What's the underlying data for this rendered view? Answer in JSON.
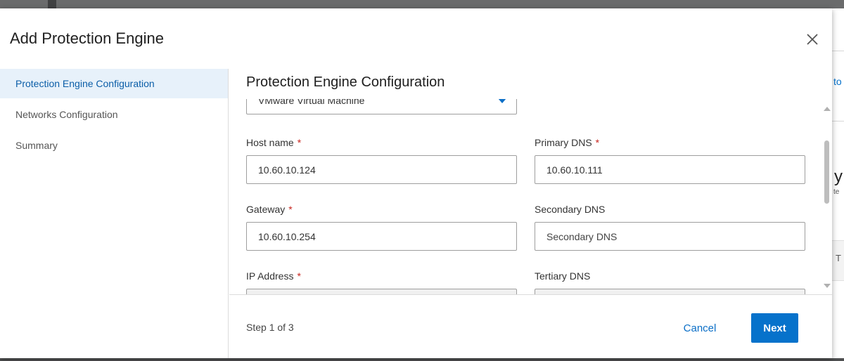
{
  "dialog": {
    "title": "Add Protection Engine"
  },
  "sidebar": {
    "items": [
      {
        "label": "Protection Engine Configuration",
        "active": true
      },
      {
        "label": "Networks Configuration",
        "active": false
      },
      {
        "label": "Summary",
        "active": false
      }
    ]
  },
  "main": {
    "section_title": "Protection Engine Configuration",
    "deployment_select": {
      "value": "VMware Virtual Machine"
    },
    "fields": {
      "host_name": {
        "label": "Host name",
        "required": true,
        "value": "10.60.10.124",
        "placeholder": ""
      },
      "primary_dns": {
        "label": "Primary DNS",
        "required": true,
        "value": "10.60.10.111",
        "placeholder": ""
      },
      "gateway": {
        "label": "Gateway",
        "required": true,
        "value": "10.60.10.254",
        "placeholder": ""
      },
      "secondary_dns": {
        "label": "Secondary DNS",
        "required": false,
        "value": "",
        "placeholder": "Secondary DNS"
      },
      "ip_address": {
        "label": "IP Address",
        "required": true,
        "value": "",
        "placeholder": ""
      },
      "tertiary_dns": {
        "label": "Tertiary DNS",
        "required": false,
        "value": "",
        "placeholder": ""
      }
    },
    "required_marker": "*"
  },
  "footer": {
    "step_text": "Step 1 of 3",
    "cancel_label": "Cancel",
    "next_label": "Next"
  },
  "background": {
    "peek_link": "to",
    "peek_heading": "y",
    "peek_small": "te",
    "peek_tab": "T"
  },
  "colors": {
    "accent": "#0672cb",
    "active_nav_bg": "#e7f1fa",
    "required": "#c8261f"
  }
}
